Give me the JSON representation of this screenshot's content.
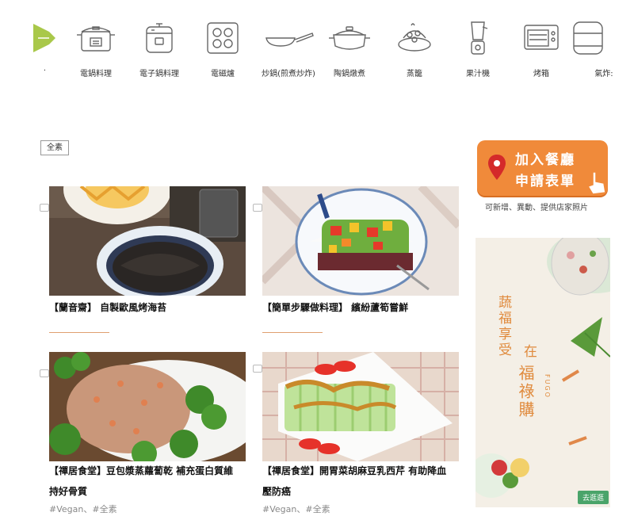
{
  "categories": [
    {
      "label": "·",
      "icon": "green-fan-icon"
    },
    {
      "label": "電鍋料理",
      "icon": "electric-rice-cooker-icon"
    },
    {
      "label": "電子鍋料理",
      "icon": "pressure-cooker-icon"
    },
    {
      "label": "電磁爐",
      "icon": "induction-cooktop-icon"
    },
    {
      "label": "炒鍋(煎煮炒炸)",
      "icon": "frying-pan-icon"
    },
    {
      "label": "陶鍋燉煮",
      "icon": "clay-pot-icon"
    },
    {
      "label": "蒸籠",
      "icon": "steamer-basket-icon"
    },
    {
      "label": "果汁機",
      "icon": "blender-icon"
    },
    {
      "label": "烤箱",
      "icon": "oven-icon"
    },
    {
      "label": "氣炸:",
      "icon": "air-fryer-icon"
    }
  ],
  "filter_tag": "全素",
  "articles": [
    {
      "title": "【蘭音齋】 自製歐風烤海苔",
      "tags": ""
    },
    {
      "title": "【簡單步驟做料理】 繽紛蘆筍嘗鮮",
      "tags": ""
    },
    {
      "title_line1": "【禪居食堂】豆包漿蒸蘿蔔乾 補充蛋白質維",
      "title_line2": "持好骨質",
      "tags": "#Vegan、#全素"
    },
    {
      "title_line1": "【禪居食堂】開胃菜胡麻豆乳西芹 有助降血",
      "title_line2": "壓防癌",
      "tags": "#Vegan、#全素"
    }
  ],
  "join_badge": {
    "line1": "加入餐廳",
    "line2": "申請表單"
  },
  "join_subtext": "可新增、異動、提供店家照片",
  "ad": {
    "text_col1": "蔬福享受",
    "text_col2": "在",
    "text_col3": "福祿購",
    "brand": "FUGO",
    "cta": "去逛逛"
  },
  "colors": {
    "accent_orange": "#f08a3a",
    "underline": "#e0a070",
    "cta_green": "#4aa46a"
  }
}
